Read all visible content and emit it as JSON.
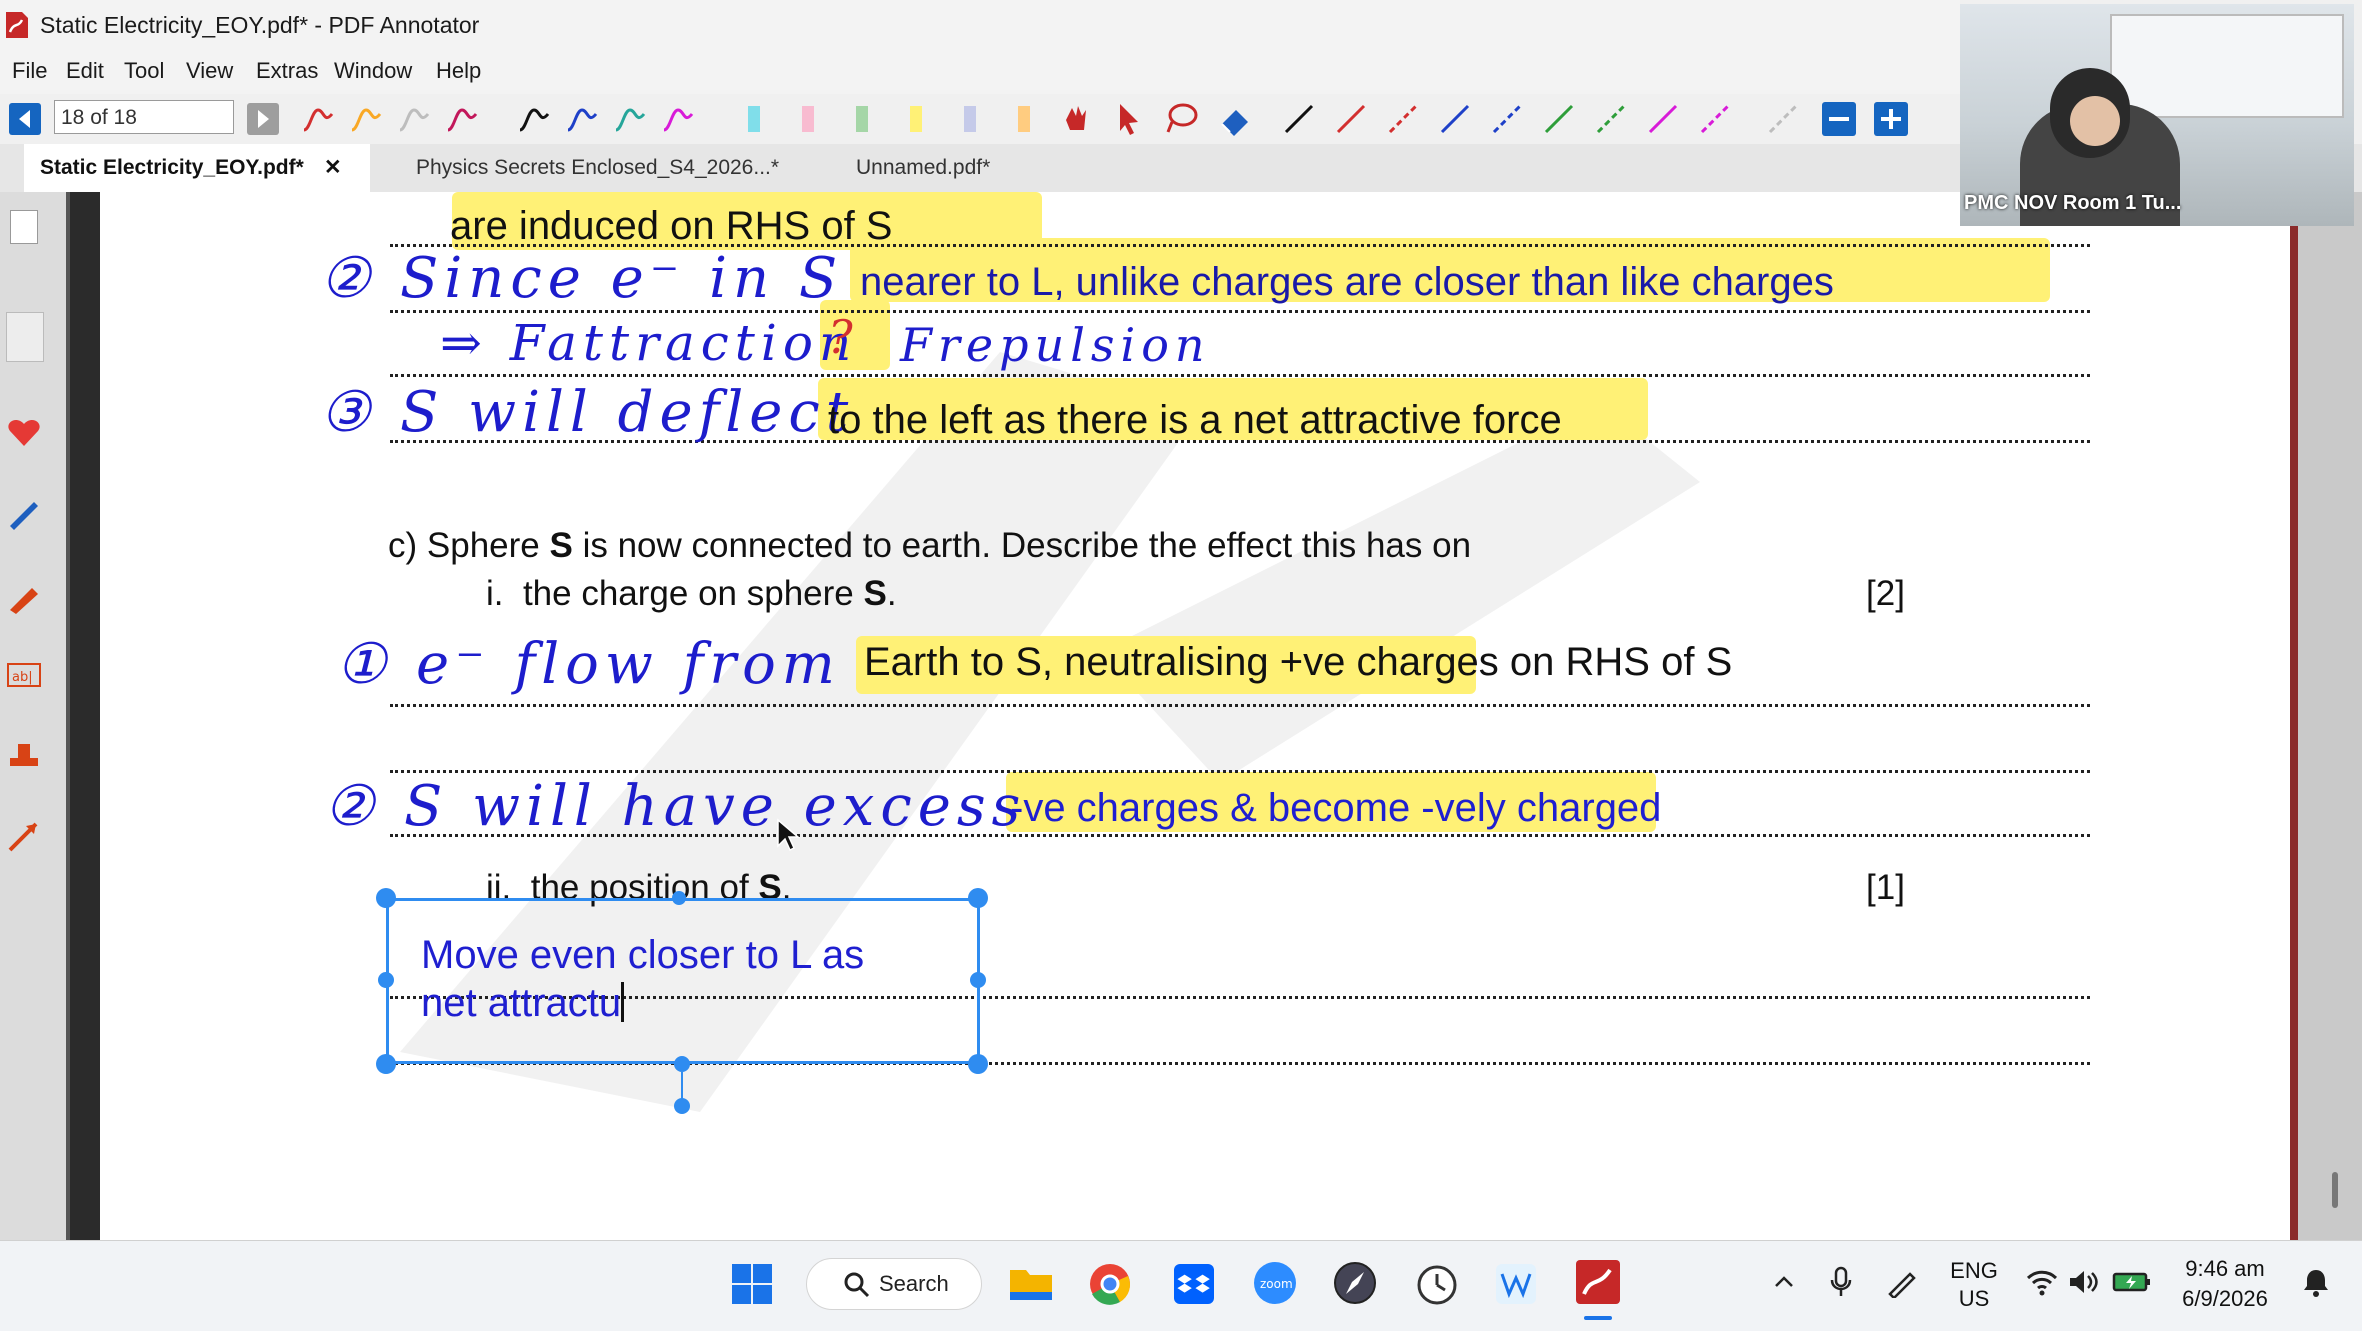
{
  "window": {
    "title": "Static Electricity_EOY.pdf* - PDF Annotator"
  },
  "menu": [
    "File",
    "Edit",
    "Tool",
    "View",
    "Extras",
    "Window",
    "Help"
  ],
  "toolbar": {
    "page_indicator": "18 of 18"
  },
  "tabs": [
    {
      "label": "Static Electricity_EOY.pdf*",
      "close": "✕"
    },
    {
      "label": "Physics Secrets Enclosed_S4_2026...*"
    },
    {
      "label": "Unnamed.pdf*"
    }
  ],
  "document": {
    "line_induced": "are induced on RHS of S",
    "hand_2a": "② Since e⁻ in S",
    "typed_nearer": "nearer to L, unlike charges are closer than like charges",
    "hand_arrow": "⇒ Fattraction",
    "hand_gt": "?",
    "hand_frep": "Frepulsion",
    "hand_3": "③ S will deflect",
    "typed_deflect": "to the left as there is a net attractive force",
    "q_c_label": "c)",
    "q_c_text_pre": "Sphere ",
    "q_c_bold": "S",
    "q_c_text_post": " is now connected to earth. Describe the effect this has on",
    "q_i_label": "i.",
    "q_i_text": "the charge on sphere ",
    "q_i_bold": "S",
    "q_i_end": ".",
    "q_i_marks": "[2]",
    "hand_1": "① e⁻ flow from",
    "typed_earth": "Earth to S, neutralising +ve charges on RHS of S",
    "hand_2b": "② S will have excess",
    "typed_excess": "-ve charges & become -vely charged",
    "q_ii_label": "ii.",
    "q_ii_text": "the position of ",
    "q_ii_bold": "S",
    "q_ii_end": ".",
    "q_ii_marks": "[1]",
    "textbox_line1": "Move even closer to L as",
    "textbox_line2": "net attractu"
  },
  "webcam": {
    "label": "PMC NOV Room 1 Tu..."
  },
  "taskbar": {
    "search_label": "Search",
    "lang_top": "ENG",
    "lang_bottom": "US",
    "time": "9:46 am",
    "date": "6/9/2026"
  },
  "colors": {
    "highlight": "#fff176",
    "typed_blue": "#1f1fd0",
    "accent": "#2f8cf0"
  }
}
